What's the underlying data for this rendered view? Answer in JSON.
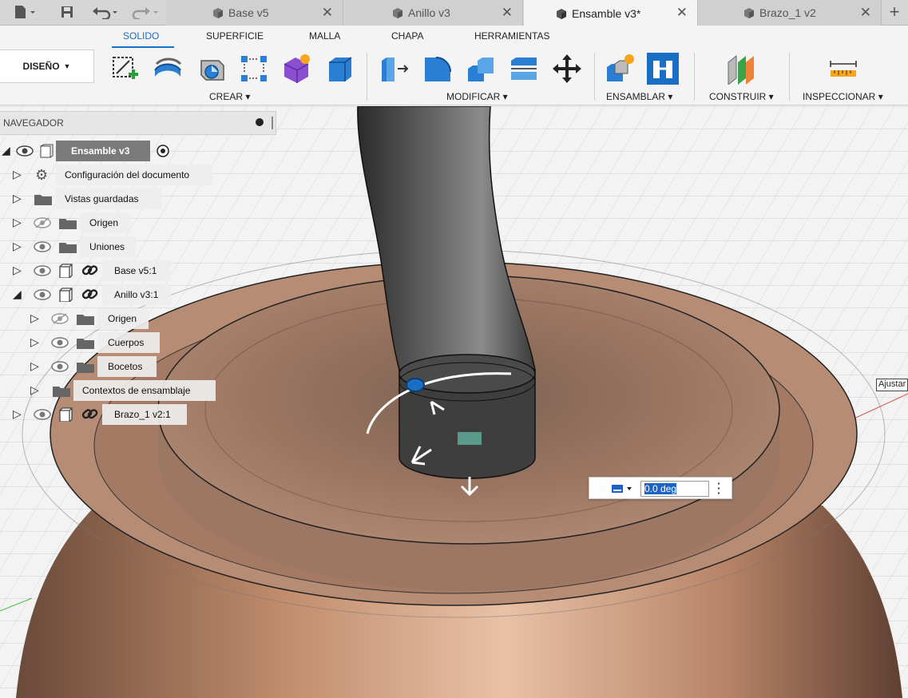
{
  "tabs": [
    {
      "label": "Base v5"
    },
    {
      "label": "Anillo v3"
    },
    {
      "label": "Ensamble v3*",
      "active": true
    },
    {
      "label": "Brazo_1 v2"
    }
  ],
  "toolbar": {
    "mode_label": "DISEÑO",
    "workspace_tabs": [
      "SOLIDO",
      "SUPERFICIE",
      "MALLA",
      "CHAPA",
      "HERRAMIENTAS"
    ],
    "groups": [
      "CREAR",
      "MODIFICAR",
      "ENSAMBLAR",
      "CONSTRUIR",
      "INSPECCIONAR"
    ]
  },
  "navigator": {
    "title": "NAVEGADOR",
    "root": "Ensamble v3",
    "items": [
      {
        "label": "Configuración del documento"
      },
      {
        "label": "Vistas guardadas"
      },
      {
        "label": "Origen"
      },
      {
        "label": "Uniones"
      },
      {
        "label": "Base v5:1"
      },
      {
        "label": "Anillo v3:1"
      },
      {
        "label": "Origen"
      },
      {
        "label": "Cuerpos"
      },
      {
        "label": "Bocetos"
      },
      {
        "label": "Contextos de ensamblaje"
      },
      {
        "label": "Brazo_1 v2:1"
      }
    ]
  },
  "rotate_input": {
    "value": "0.0 deg"
  },
  "viewport_label": "Ajustar",
  "colors": {
    "accent": "#1a6fc4",
    "copper": "#a47a64",
    "arm": "#3a3a3a"
  }
}
